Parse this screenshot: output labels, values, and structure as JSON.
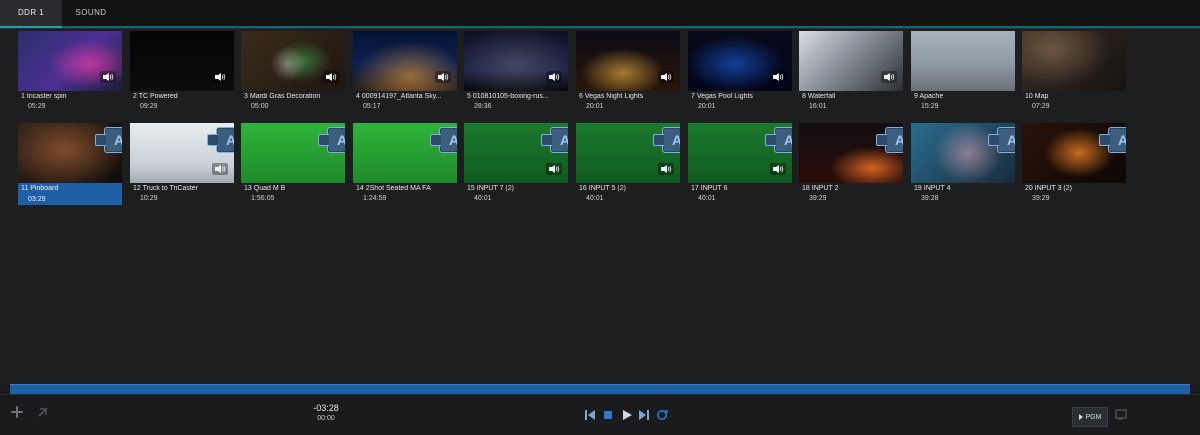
{
  "tabs": [
    {
      "label": "DDR 1",
      "active": true
    },
    {
      "label": "SOUND",
      "active": false
    }
  ],
  "media": [
    {
      "index": "1",
      "title": "tricaster spin",
      "duration": "05:29",
      "theme": "tricaster",
      "has_audio": true,
      "chip": false
    },
    {
      "index": "2",
      "title": "TC Powered",
      "duration": "09:29",
      "theme": "black",
      "has_audio": true,
      "chip": false
    },
    {
      "index": "3",
      "title": "Mardi Gras Decoration",
      "duration": "05:00",
      "theme": "food",
      "has_audio": true,
      "chip": false
    },
    {
      "index": "4",
      "title": "000914197_Atlanta Sky...",
      "duration": "05:17",
      "theme": "city_night",
      "has_audio": true,
      "chip": false
    },
    {
      "index": "5",
      "title": "010810105-boxing-rus...",
      "duration": "28:36",
      "theme": "arena",
      "has_audio": true,
      "chip": false
    },
    {
      "index": "6",
      "title": "Vegas Night Lights",
      "duration": "20:01",
      "theme": "vegas",
      "has_audio": true,
      "chip": false
    },
    {
      "index": "7",
      "title": "Vegas Pool Lights",
      "duration": "20:01",
      "theme": "pool",
      "has_audio": true,
      "chip": false
    },
    {
      "index": "8",
      "title": "Waterfall",
      "duration": "16:01",
      "theme": "waterfall",
      "has_audio": true,
      "chip": false
    },
    {
      "index": "9",
      "title": "Apache",
      "duration": "15:29",
      "theme": "apache",
      "has_audio": false,
      "chip": false
    },
    {
      "index": "10",
      "title": "Map",
      "duration": "07:29",
      "theme": "map",
      "has_audio": false,
      "chip": false
    },
    {
      "index": "11",
      "title": "Pinboard",
      "duration": "03:29",
      "theme": "pinboard",
      "has_audio": false,
      "chip": true,
      "selected": true
    },
    {
      "index": "12",
      "title": "Truck to TriCaster",
      "duration": "10:29",
      "theme": "truck",
      "has_audio": true,
      "chip": true
    },
    {
      "index": "13",
      "title": "Quad M B",
      "duration": "1:56:05",
      "theme": "green_1",
      "has_audio": false,
      "chip": true
    },
    {
      "index": "14",
      "title": "2Shot Seated MA FA",
      "duration": "1:24:59",
      "theme": "green_2",
      "has_audio": false,
      "chip": true
    },
    {
      "index": "15",
      "title": "INPUT 7 (2)",
      "duration": "40:01",
      "theme": "soccer",
      "has_audio": true,
      "chip": true
    },
    {
      "index": "16",
      "title": "INPUT 5 (2)",
      "duration": "40:01",
      "theme": "soccer",
      "has_audio": true,
      "chip": true
    },
    {
      "index": "17",
      "title": "INPUT 6",
      "duration": "40:01",
      "theme": "soccer",
      "has_audio": true,
      "chip": true
    },
    {
      "index": "18",
      "title": "INPUT 2",
      "duration": "39:29",
      "theme": "fire",
      "has_audio": false,
      "chip": true
    },
    {
      "index": "19",
      "title": "INPUT 4",
      "duration": "39:28",
      "theme": "headset",
      "has_audio": false,
      "chip": true
    },
    {
      "index": "20",
      "title": "INPUT 3 (2)",
      "duration": "39:29",
      "theme": "sparks",
      "has_audio": false,
      "chip": true
    }
  ],
  "bottom": {
    "timecode_main": "-03:28",
    "timecode_sub": "00:00",
    "pgm_label": "PGM"
  },
  "colors": {
    "accent_teal": "#1ea0b0",
    "timeline_blue": "#1e5fa5",
    "selected_blue": "#1e5fa5"
  }
}
